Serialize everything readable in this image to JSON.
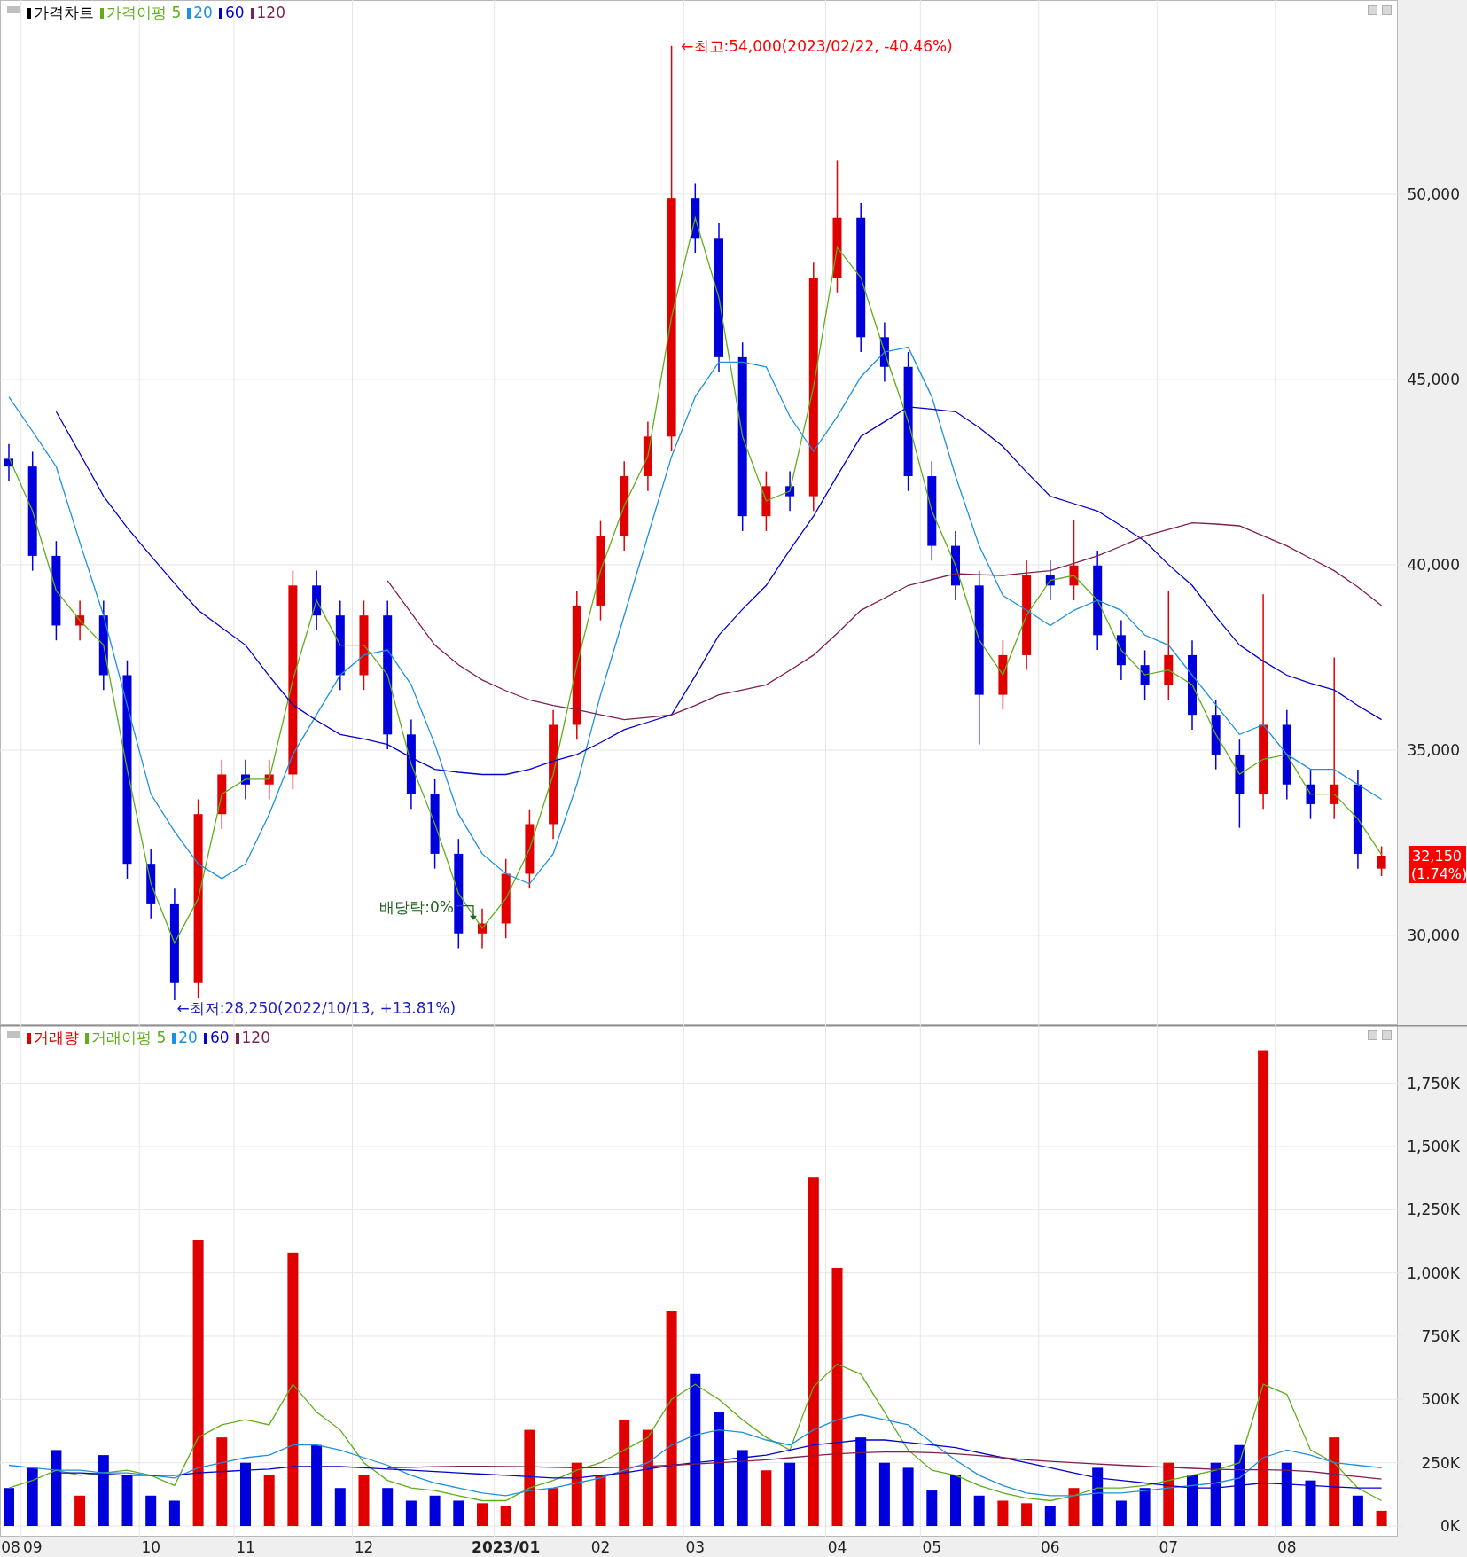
{
  "price_panel": {
    "title": {
      "text": "가격차트",
      "color": "#000000"
    },
    "current_price": {
      "value": "32,150",
      "change": "(1.74%)"
    },
    "chart_data": {
      "type": "candlestick",
      "grid": true,
      "categories": [
        null,
        null,
        null,
        null,
        null,
        null,
        null,
        null,
        null,
        null,
        null,
        null,
        null,
        null,
        null,
        null,
        null,
        null,
        null,
        null,
        null,
        null,
        null,
        null,
        null,
        null,
        null,
        null,
        null,
        null,
        null,
        null,
        null,
        null,
        null,
        null,
        null,
        null,
        null,
        null,
        null,
        null,
        null,
        null,
        null,
        null,
        null,
        null,
        null,
        null,
        null,
        null,
        null,
        null,
        null,
        null,
        null,
        null,
        null
      ],
      "ylim": [
        27580,
        55240
      ],
      "yticks": [
        {
          "value": 30000,
          "label": "30,000"
        },
        {
          "value": 35000,
          "label": "35,000"
        },
        {
          "value": 40000,
          "label": "40,000"
        },
        {
          "value": 45000,
          "label": "45,000"
        },
        {
          "value": 50000,
          "label": "50,000"
        }
      ],
      "ohlc": [
        [
          42860,
          43260,
          42250,
          42650
        ],
        [
          42650,
          43050,
          39840,
          40240
        ],
        [
          40240,
          40640,
          37960,
          38360
        ],
        [
          38360,
          39030,
          37960,
          38630
        ],
        [
          38630,
          39030,
          36620,
          37020
        ],
        [
          37020,
          37420,
          31530,
          31930
        ],
        [
          31930,
          32330,
          30460,
          30860
        ],
        [
          30860,
          31260,
          28250,
          28710
        ],
        [
          28710,
          33670,
          28310,
          33270
        ],
        [
          33270,
          34740,
          32870,
          34340
        ],
        [
          34340,
          34740,
          33670,
          34070
        ],
        [
          34070,
          34740,
          33670,
          34340
        ],
        [
          34340,
          39840,
          33940,
          39440
        ],
        [
          39440,
          39840,
          38230,
          38630
        ],
        [
          38630,
          39030,
          36620,
          37020
        ],
        [
          37020,
          39030,
          36620,
          38630
        ],
        [
          38630,
          39030,
          35020,
          35420
        ],
        [
          35420,
          35820,
          33410,
          33810
        ],
        [
          33810,
          34210,
          31800,
          32200
        ],
        [
          32200,
          32600,
          29650,
          30050
        ],
        [
          30050,
          30720,
          29650,
          30320
        ],
        [
          30320,
          32060,
          29920,
          31660
        ],
        [
          31660,
          33400,
          31260,
          33000
        ],
        [
          33000,
          36080,
          32600,
          35680
        ],
        [
          35680,
          39300,
          35280,
          38900
        ],
        [
          38900,
          41180,
          38500,
          40780
        ],
        [
          40780,
          42790,
          40380,
          42390
        ],
        [
          42390,
          43860,
          41990,
          43460
        ],
        [
          43460,
          54000,
          43060,
          49900
        ],
        [
          49900,
          50300,
          48420,
          48820
        ],
        [
          48820,
          49220,
          45200,
          45600
        ],
        [
          45600,
          46000,
          40910,
          41310
        ],
        [
          41310,
          42520,
          40910,
          42120
        ],
        [
          42120,
          42520,
          41450,
          41850
        ],
        [
          41850,
          48150,
          41450,
          47750
        ],
        [
          47750,
          50900,
          47350,
          49360
        ],
        [
          49360,
          49760,
          45740,
          46140
        ],
        [
          46140,
          46540,
          44940,
          45340
        ],
        [
          45340,
          45740,
          41990,
          42390
        ],
        [
          42390,
          42790,
          40110,
          40510
        ],
        [
          40510,
          40910,
          39040,
          39440
        ],
        [
          39440,
          39840,
          35150,
          36490
        ],
        [
          36490,
          37960,
          36090,
          37560
        ],
        [
          37560,
          40110,
          37160,
          39710
        ],
        [
          39710,
          40110,
          39040,
          39440
        ],
        [
          39440,
          41200,
          39040,
          39980
        ],
        [
          39980,
          40380,
          37700,
          38100
        ],
        [
          38100,
          38500,
          36890,
          37290
        ],
        [
          37290,
          37690,
          36360,
          36760
        ],
        [
          36760,
          39300,
          36360,
          37560
        ],
        [
          37560,
          37960,
          35550,
          35950
        ],
        [
          35950,
          36350,
          34480,
          34880
        ],
        [
          34880,
          35280,
          32900,
          33810
        ],
        [
          33810,
          39200,
          33410,
          35680
        ],
        [
          35680,
          36080,
          33670,
          34070
        ],
        [
          34070,
          34470,
          33140,
          33540
        ],
        [
          33540,
          37500,
          33140,
          34070
        ],
        [
          34070,
          34470,
          31800,
          32200
        ],
        [
          31800,
          32400,
          31600,
          32150
        ]
      ],
      "series": [
        {
          "name": "가격이평 5",
          "type": "line",
          "color": "#5fae1a",
          "values": [
            42900,
            41450,
            39300,
            38500,
            37830,
            34480,
            31400,
            29790,
            30990,
            33810,
            34210,
            34210,
            36890,
            39040,
            37830,
            37830,
            37030,
            34620,
            33010,
            31130,
            30190,
            30990,
            32330,
            34340,
            37290,
            39840,
            41590,
            42930,
            46680,
            49360,
            47210,
            43460,
            41720,
            41990,
            44800,
            48560,
            47750,
            45740,
            43870,
            41450,
            39980,
            37970,
            37030,
            38640,
            39580,
            39710,
            39040,
            37700,
            37030,
            37160,
            36760,
            35420,
            34350,
            34750,
            34880,
            33810,
            33810,
            33140,
            32180
          ]
        },
        {
          "name": "20",
          "type": "line",
          "color": "#1e90e0",
          "values": [
            44530,
            43600,
            42650,
            40600,
            38630,
            36200,
            33810,
            32800,
            31930,
            31530,
            31930,
            33270,
            34880,
            35950,
            37020,
            37560,
            37700,
            36760,
            35150,
            33270,
            32200,
            31660,
            31390,
            32200,
            34070,
            36490,
            38630,
            40780,
            42920,
            44530,
            45470,
            45470,
            45340,
            44000,
            43060,
            44000,
            45070,
            45740,
            45870,
            44530,
            42390,
            40510,
            39170,
            38770,
            38360,
            38770,
            39040,
            38770,
            38100,
            37830,
            37020,
            36220,
            35420,
            35680,
            34880,
            34480,
            34480,
            34070,
            33670
          ]
        },
        {
          "name": "60",
          "type": "line",
          "color": "#0000d0",
          "values": [
            null,
            null,
            44130,
            43000,
            41850,
            41000,
            40240,
            39500,
            38770,
            38300,
            37830,
            37000,
            36220,
            35800,
            35420,
            35300,
            35150,
            34800,
            34480,
            34400,
            34340,
            34340,
            34480,
            34700,
            34880,
            35200,
            35550,
            35750,
            35950,
            37000,
            38100,
            38800,
            39440,
            40400,
            41310,
            42400,
            43460,
            43860,
            44260,
            44200,
            44130,
            43700,
            43190,
            42500,
            41850,
            41650,
            41450,
            41050,
            40640,
            40000,
            39440,
            38600,
            37830,
            37400,
            37020,
            36800,
            36620,
            36200,
            35820
          ]
        },
        {
          "name": "120",
          "type": "line",
          "color": "#7f1f4f",
          "values": [
            null,
            null,
            null,
            null,
            null,
            null,
            null,
            null,
            null,
            null,
            null,
            null,
            null,
            null,
            null,
            null,
            39570,
            38700,
            37830,
            37300,
            36890,
            36600,
            36350,
            36200,
            36090,
            35950,
            35820,
            35880,
            35950,
            36200,
            36490,
            36620,
            36760,
            37150,
            37560,
            38150,
            38770,
            39100,
            39440,
            39600,
            39760,
            39730,
            39710,
            39780,
            39840,
            40040,
            40240,
            40500,
            40780,
            40950,
            41130,
            41100,
            41050,
            40780,
            40510,
            40170,
            39840,
            39400,
            38900
          ]
        }
      ],
      "annotations": [
        "←최고:54,000(2023/02/22, -40.46%)",
        "←최저:28,250(2022/10/13, +13.81%)",
        "배당락:0%"
      ]
    }
  },
  "volume_panel": {
    "chart_data": {
      "type": "bar",
      "grid": true,
      "categories": [
        "08",
        "09",
        null,
        null,
        null,
        null,
        "10",
        null,
        null,
        null,
        "11",
        null,
        null,
        null,
        null,
        "12",
        null,
        null,
        null,
        null,
        null,
        "2023/01",
        null,
        null,
        null,
        "02",
        null,
        null,
        null,
        "03",
        null,
        null,
        null,
        null,
        null,
        "04",
        null,
        null,
        null,
        "05",
        null,
        null,
        null,
        null,
        "06",
        null,
        null,
        null,
        null,
        "07",
        null,
        null,
        null,
        null,
        "08",
        null,
        null,
        null,
        null
      ],
      "ylim": [
        -42,
        1980
      ],
      "yticks": [
        {
          "value": 0,
          "label": "0K"
        },
        {
          "value": 250,
          "label": "250K"
        },
        {
          "value": 500,
          "label": "500K"
        },
        {
          "value": 750,
          "label": "750K"
        },
        {
          "value": 1000,
          "label": "1,000K"
        },
        {
          "value": 1250,
          "label": "1,250K"
        },
        {
          "value": 1500,
          "label": "1,500K"
        },
        {
          "value": 1750,
          "label": "1,750K"
        }
      ],
      "series": [
        {
          "name": "거래량",
          "color": "#e00000",
          "values": [
            null,
            null,
            null,
            120,
            null,
            null,
            null,
            null,
            1130,
            350,
            null,
            200,
            1080,
            null,
            null,
            200,
            null,
            null,
            null,
            null,
            90,
            80,
            380,
            150,
            250,
            200,
            420,
            380,
            850,
            null,
            null,
            null,
            220,
            null,
            1380,
            1020,
            null,
            null,
            null,
            null,
            null,
            null,
            100,
            90,
            null,
            150,
            null,
            null,
            null,
            250,
            null,
            null,
            null,
            1880,
            null,
            null,
            350,
            null,
            60
          ]
        },
        {
          "color": "#0000dd",
          "values": [
            150,
            230,
            300,
            null,
            280,
            200,
            120,
            100,
            null,
            null,
            250,
            null,
            null,
            320,
            150,
            null,
            150,
            100,
            120,
            100,
            null,
            null,
            null,
            null,
            null,
            null,
            null,
            null,
            null,
            600,
            450,
            300,
            null,
            250,
            null,
            null,
            350,
            250,
            230,
            140,
            200,
            120,
            null,
            null,
            80,
            null,
            230,
            100,
            150,
            null,
            200,
            250,
            320,
            null,
            250,
            180,
            null,
            120,
            null
          ]
        },
        {
          "name": "거래이평 5",
          "type": "line",
          "color": "#5fae1a",
          "values": [
            150,
            180,
            220,
            200,
            210,
            220,
            200,
            160,
            350,
            400,
            420,
            400,
            560,
            450,
            380,
            250,
            180,
            150,
            140,
            120,
            100,
            100,
            150,
            180,
            220,
            250,
            300,
            350,
            500,
            560,
            500,
            420,
            350,
            300,
            550,
            640,
            600,
            450,
            300,
            220,
            200,
            160,
            130,
            110,
            100,
            120,
            150,
            150,
            160,
            180,
            200,
            220,
            250,
            560,
            520,
            300,
            250,
            150,
            100
          ]
        },
        {
          "name": "20",
          "type": "line",
          "color": "#1e90e0",
          "values": [
            240,
            230,
            220,
            220,
            210,
            210,
            200,
            190,
            230,
            250,
            270,
            280,
            320,
            320,
            300,
            270,
            240,
            200,
            170,
            150,
            130,
            120,
            140,
            150,
            170,
            190,
            220,
            250,
            320,
            360,
            380,
            370,
            340,
            320,
            380,
            420,
            440,
            420,
            400,
            330,
            260,
            200,
            160,
            130,
            120,
            120,
            130,
            130,
            140,
            150,
            160,
            170,
            190,
            270,
            300,
            280,
            250,
            240,
            230
          ]
        },
        {
          "name": "60",
          "type": "line",
          "color": "#0000d0",
          "values": [
            null,
            null,
            210,
            210,
            205,
            200,
            200,
            200,
            210,
            215,
            220,
            225,
            235,
            235,
            235,
            230,
            225,
            220,
            215,
            210,
            205,
            200,
            195,
            190,
            190,
            200,
            210,
            225,
            240,
            250,
            260,
            270,
            280,
            300,
            320,
            330,
            340,
            340,
            330,
            320,
            310,
            290,
            270,
            250,
            230,
            210,
            190,
            180,
            170,
            160,
            150,
            150,
            160,
            170,
            165,
            160,
            155,
            150,
            150
          ]
        },
        {
          "name": "120",
          "type": "line",
          "color": "#7f1f4f",
          "values": [
            null,
            null,
            null,
            null,
            null,
            null,
            null,
            null,
            null,
            null,
            null,
            null,
            null,
            null,
            null,
            null,
            230,
            232,
            234,
            236,
            236,
            235,
            234,
            232,
            230,
            230,
            232,
            236,
            240,
            245,
            250,
            255,
            262,
            270,
            278,
            285,
            290,
            292,
            292,
            290,
            285,
            278,
            270,
            262,
            255,
            250,
            245,
            240,
            236,
            232,
            228,
            224,
            222,
            222,
            220,
            215,
            205,
            195,
            185
          ]
        }
      ]
    }
  }
}
